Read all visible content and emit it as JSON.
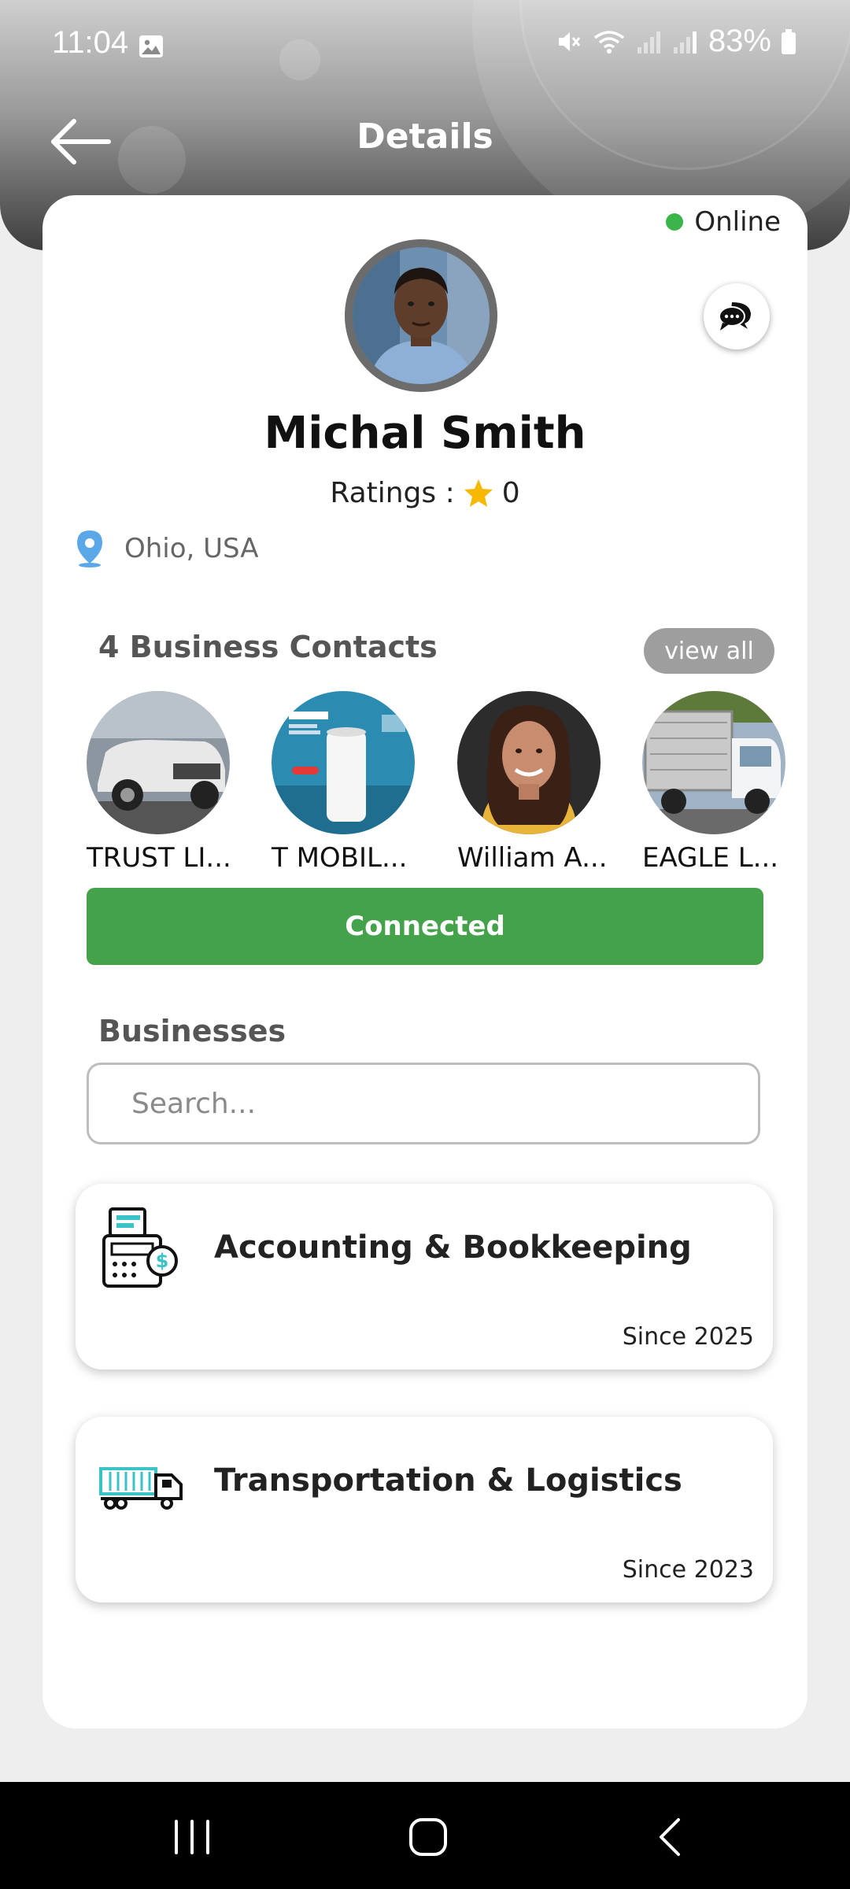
{
  "status_bar": {
    "time": "11:04",
    "battery": "83%",
    "icons": [
      "gallery-icon",
      "mute-icon",
      "wifi-icon",
      "signal-icon",
      "signal-icon",
      "battery-icon"
    ]
  },
  "header": {
    "title": "Details",
    "back_icon": "arrow-left-icon"
  },
  "profile": {
    "status": "Online",
    "status_color": "#3ab54a",
    "name": "Michal Smith",
    "ratings_label": "Ratings :",
    "rating_value": "0",
    "location": "Ohio, USA",
    "chat_icon": "chat-bubbles-icon"
  },
  "contacts": {
    "title": "4 Business Contacts",
    "view_all": "view all",
    "items": [
      {
        "name": "TRUST LI..."
      },
      {
        "name": "T MOBIL..."
      },
      {
        "name": "William A..."
      },
      {
        "name": "EAGLE L..."
      }
    ]
  },
  "connect_button": {
    "label": "Connected",
    "color": "#43a24a"
  },
  "businesses": {
    "title": "Businesses",
    "search_placeholder": "Search...",
    "items": [
      {
        "name": "Accounting & Bookkeeping",
        "since": "Since 2025",
        "icon": "accounting-icon"
      },
      {
        "name": "Transportation & Logistics",
        "since": "Since 2023",
        "icon": "truck-icon"
      }
    ]
  },
  "nav_bar": {
    "icons": [
      "recent-apps-icon",
      "home-icon",
      "back-nav-icon"
    ]
  }
}
